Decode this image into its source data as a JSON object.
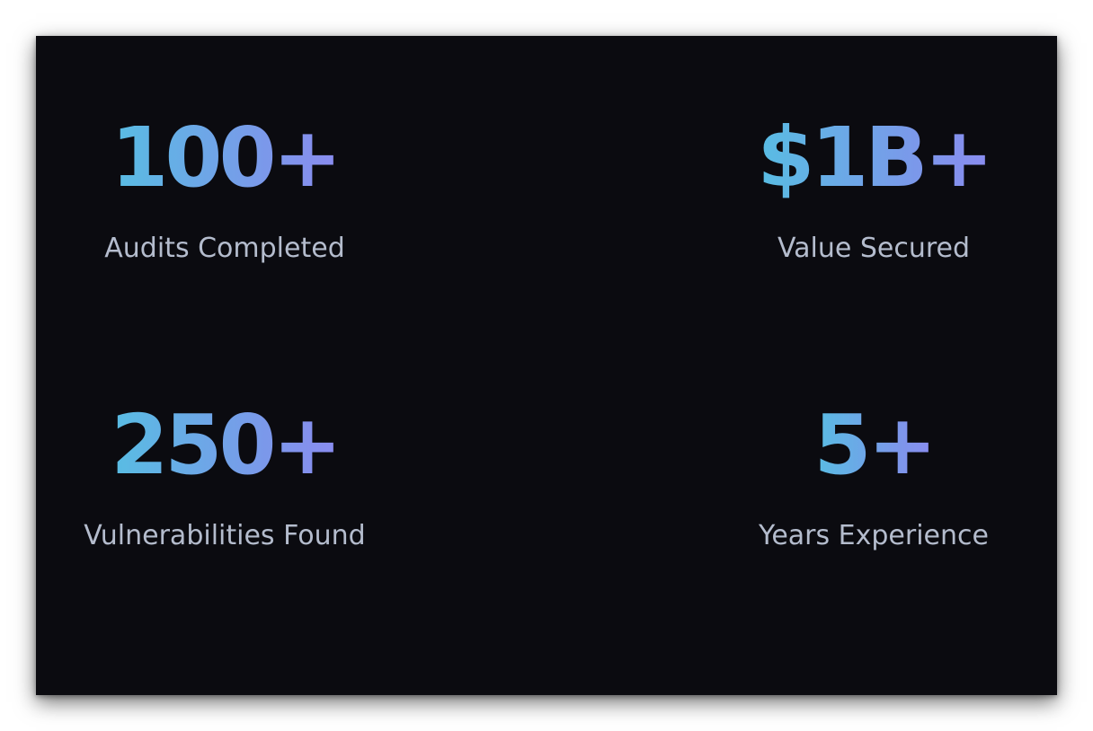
{
  "stats": [
    {
      "value": "100+",
      "label": "Audits Completed"
    },
    {
      "value": "$1B+",
      "label": "Value Secured"
    },
    {
      "value": "250+",
      "label": "Vulnerabilities Found"
    },
    {
      "value": "5+",
      "label": "Years Experience"
    }
  ],
  "colors": {
    "background": "#0b0b10",
    "gradient_start": "#58bde3",
    "gradient_end": "#8a8cf0",
    "label": "#b4bccd"
  }
}
